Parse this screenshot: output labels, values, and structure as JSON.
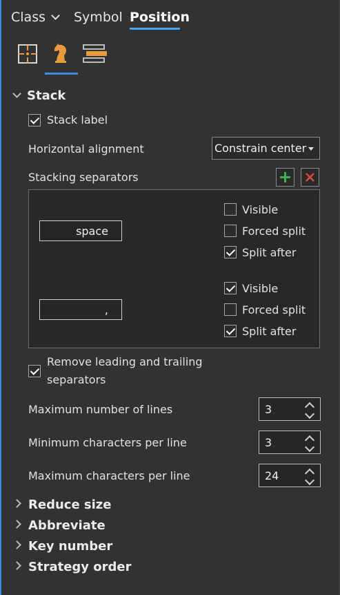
{
  "tabs": {
    "class_label": "Class",
    "symbol_label": "Symbol",
    "position_label": "Position"
  },
  "icon_tabs": [
    "placement-grid-icon",
    "chess-knight-icon",
    "layers-stack-icon"
  ],
  "stack": {
    "header": "Stack",
    "stack_label_checkbox": {
      "label": "Stack label",
      "checked": true
    },
    "horizontal_alignment": {
      "label": "Horizontal alignment",
      "value": "Constrain center"
    },
    "separators": {
      "label": "Stacking separators",
      "items": [
        {
          "value": "space",
          "visible_label": "Visible",
          "visible": false,
          "forced_label": "Forced split",
          "forced": false,
          "after_label": "Split after",
          "after": true
        },
        {
          "value": ",",
          "visible_label": "Visible",
          "visible": true,
          "forced_label": "Forced split",
          "forced": false,
          "after_label": "Split after",
          "after": true
        }
      ]
    },
    "remove_separators": {
      "label_line1": "Remove leading and trailing",
      "label_line2": "separators",
      "checked": true
    },
    "max_lines": {
      "label": "Maximum number of lines",
      "value": "3"
    },
    "min_chars": {
      "label": "Minimum characters per line",
      "value": "3"
    },
    "max_chars": {
      "label": "Maximum characters per line",
      "value": "24"
    }
  },
  "sections": {
    "reduce_size": "Reduce size",
    "abbreviate": "Abbreviate",
    "key_number": "Key number",
    "strategy_order": "Strategy order"
  },
  "colors": {
    "background": "#323232",
    "accent": "#4aa3ef",
    "add_green": "#3fb24f",
    "remove_red": "#e0483c",
    "icon_orange": "#e89a3c"
  }
}
